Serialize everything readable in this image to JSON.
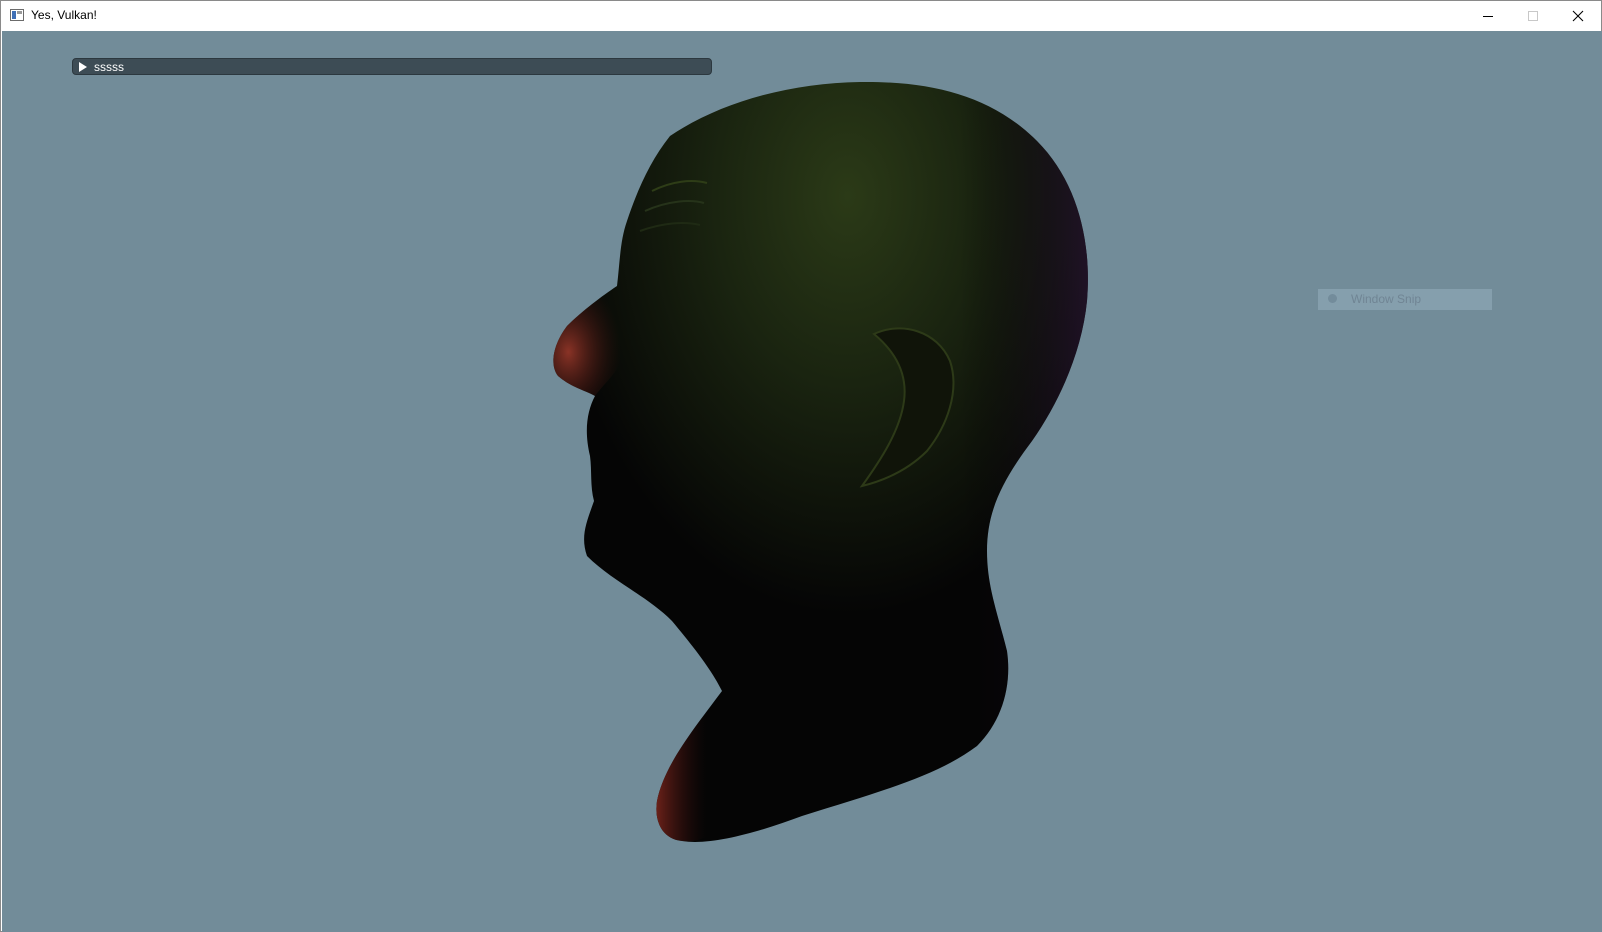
{
  "window": {
    "title": "Yes, Vulkan!",
    "icon": "app-window-icon"
  },
  "caption_buttons": {
    "minimize_icon": "minimize-icon",
    "maximize_icon": "maximize-icon",
    "close_icon": "close-icon"
  },
  "scene": {
    "background_color": "#728c99",
    "model": "head-mesh"
  },
  "imgui": {
    "header_label": "sssss",
    "arrow_icon": "collapsed-arrow-icon"
  },
  "snip_overlay": {
    "label": "Window Snip",
    "icon": "snip-dot-icon"
  }
}
